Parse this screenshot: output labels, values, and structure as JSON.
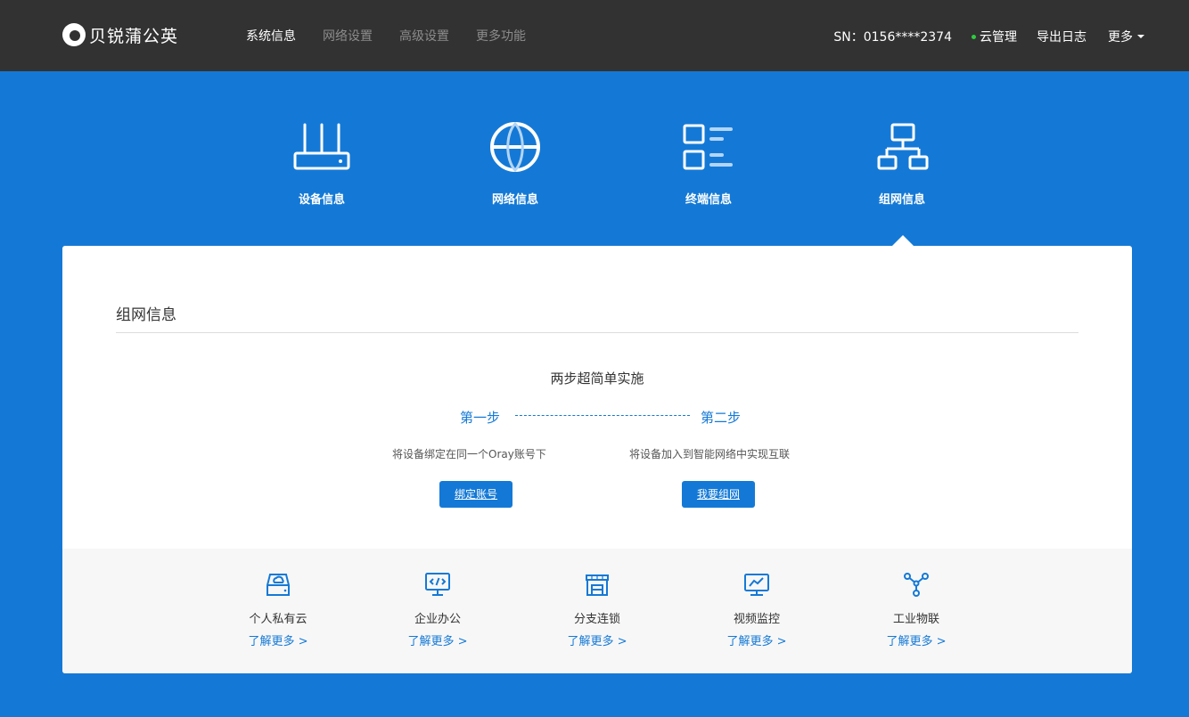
{
  "header": {
    "logo_text": "贝锐蒲公英",
    "nav": [
      {
        "label": "系统信息",
        "active": true
      },
      {
        "label": "网络设置",
        "active": false
      },
      {
        "label": "高级设置",
        "active": false
      },
      {
        "label": "更多功能",
        "active": false
      }
    ],
    "sn": "SN：0156****2374",
    "cloud_manage": "云管理",
    "export_log": "导出日志",
    "more": "更多"
  },
  "categories": [
    {
      "label": "设备信息",
      "icon": "router-icon"
    },
    {
      "label": "网络信息",
      "icon": "globe-icon"
    },
    {
      "label": "终端信息",
      "icon": "terminal-list-icon"
    },
    {
      "label": "组网信息",
      "icon": "network-topology-icon"
    }
  ],
  "panel": {
    "title": "组网信息",
    "steps_title": "两步超简单实施",
    "step1": "第一步",
    "step2": "第二步",
    "desc1": "将设备绑定在同一个Oray账号下",
    "desc2": "将设备加入到智能网络中实现互联",
    "btn1": "绑定账号",
    "btn2": "我要组网"
  },
  "features": [
    {
      "name": "个人私有云",
      "link": "了解更多 >",
      "icon": "cloud-drive-icon"
    },
    {
      "name": "企业办公",
      "link": "了解更多 >",
      "icon": "code-monitor-icon"
    },
    {
      "name": "分支连锁",
      "link": "了解更多 >",
      "icon": "store-icon"
    },
    {
      "name": "视频监控",
      "link": "了解更多 >",
      "icon": "monitor-chart-icon"
    },
    {
      "name": "工业物联",
      "link": "了解更多 >",
      "icon": "iot-nodes-icon"
    }
  ],
  "colors": {
    "brand_blue": "#1479d6",
    "header_bg": "#323232",
    "status_green": "#2ecc40"
  }
}
